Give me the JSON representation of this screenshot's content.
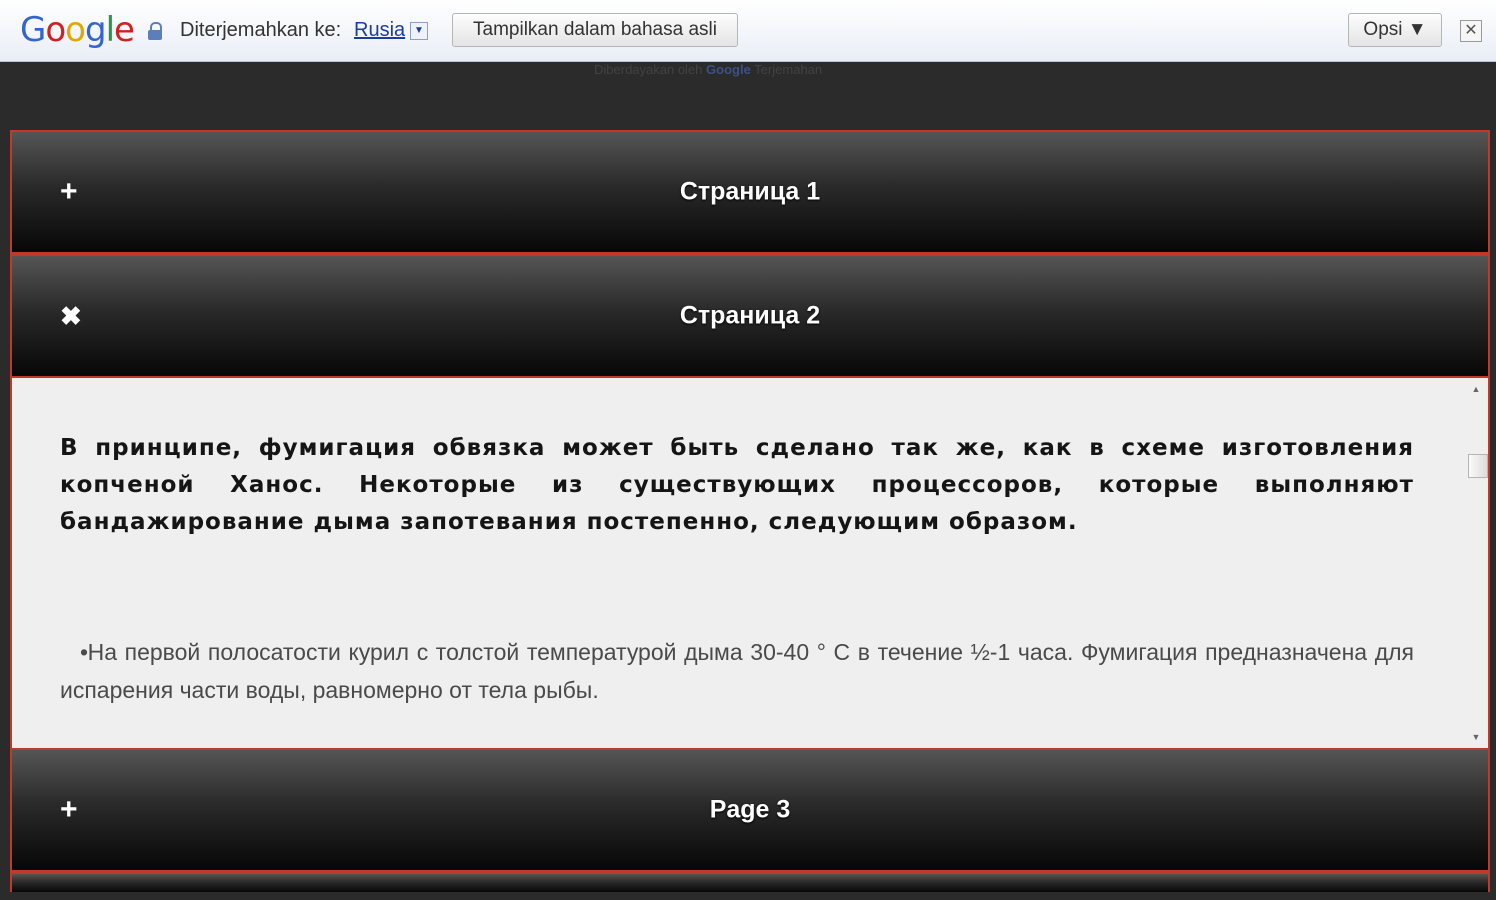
{
  "translate_bar": {
    "logo": "Google",
    "translated_to_label": "Diterjemahkan ke:",
    "language": "Rusia",
    "show_original_label": "Tampilkan dalam bahasa asli",
    "options_label": "Opsi ▼",
    "close_symbol": "✕",
    "powered_prefix": "Diberdayakan oleh",
    "powered_brand": "Google",
    "powered_suffix": "Terjemahan"
  },
  "accordion": {
    "panels": [
      {
        "title": "Страница 1",
        "icon": "+",
        "icon_name": "plus-icon",
        "expanded": false
      },
      {
        "title": "Страница 2",
        "icon": "✖",
        "icon_name": "close-icon",
        "expanded": true,
        "content": {
          "lead": "В принципе, фумигация обвязка может быть сделано так же, как в схеме изготовления копченой Ханос. Некоторые из существующих процессоров, которые выполняют бандажирование дыма запотевания постепенно, следующим образом.",
          "bullet": "На первой полосатости курил с толстой температурой дыма 30-40 ° C в течение ½-1 часа. Фумигация предназначена для испарения части воды, равномерно от тела рыбы."
        }
      },
      {
        "title": "Page 3",
        "icon": "+",
        "icon_name": "plus-icon",
        "expanded": false
      }
    ]
  },
  "colors": {
    "accent_border": "#c0392b",
    "header_dark": "#070707",
    "content_bg": "#efefef"
  }
}
